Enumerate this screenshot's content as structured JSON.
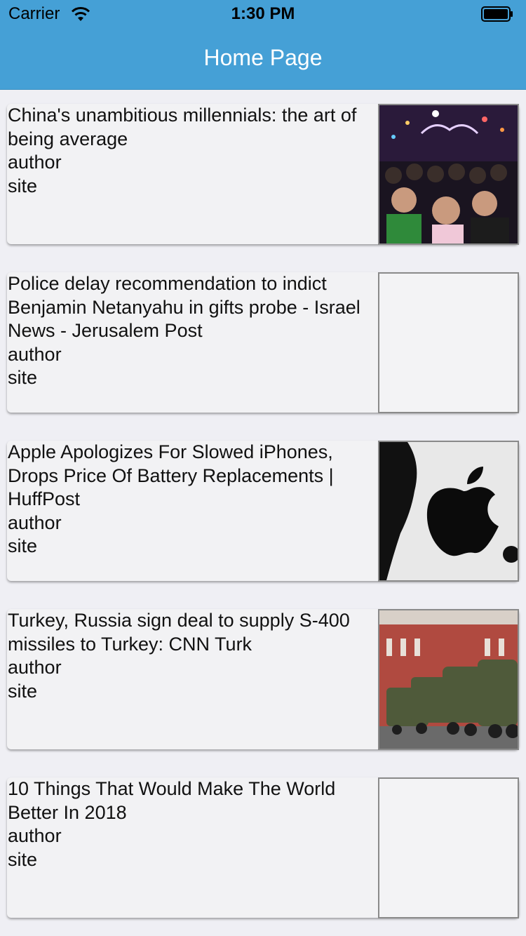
{
  "status_bar": {
    "carrier": "Carrier",
    "time": "1:30 PM"
  },
  "nav": {
    "title": "Home Page"
  },
  "articles": [
    {
      "title": "China's unambitious millennials: the art of being average",
      "author": "author",
      "site": "site",
      "thumbnail": "crowd-photo"
    },
    {
      "title": "Police delay recommendation to indict Benjamin Netanyahu in gifts probe - Israel News - Jerusalem Post",
      "author": "author",
      "site": "site",
      "thumbnail": "empty"
    },
    {
      "title": "Apple Apologizes For Slowed iPhones, Drops Price Of Battery Replacements | HuffPost",
      "author": "author",
      "site": "site",
      "thumbnail": "apple-logo-photo"
    },
    {
      "title": "Turkey, Russia sign deal to supply S-400 missiles to Turkey: CNN Turk",
      "author": "author",
      "site": "site",
      "thumbnail": "missile-trucks-photo"
    },
    {
      "title": "10 Things That Would Make The World Better In 2018",
      "author": "author",
      "site": "site",
      "thumbnail": "empty"
    }
  ]
}
